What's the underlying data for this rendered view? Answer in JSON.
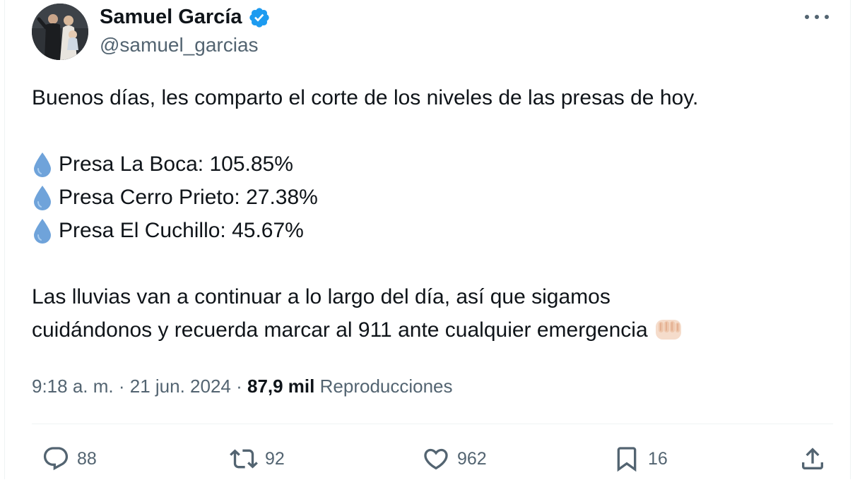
{
  "author": {
    "name": "Samuel García",
    "handle": "@samuel_garcias",
    "verified": true
  },
  "tweet": {
    "intro": "Buenos días, les comparto el corte de los niveles de las presas de hoy.",
    "dams": [
      {
        "icon": "droplet-icon",
        "text": "Presa La Boca: 105.85%"
      },
      {
        "icon": "droplet-icon",
        "text": "Presa Cerro Prieto: 27.38%"
      },
      {
        "icon": "droplet-icon",
        "text": "Presa El Cuchillo: 45.67%"
      }
    ],
    "closing_line1": "Las lluvias van a continuar a lo largo del día, así que sigamos",
    "closing_line2": "cuidándonos y recuerda marcar al 911 ante cualquier emergencia",
    "closing_emoji": "oncoming-fist-icon"
  },
  "meta": {
    "time": "9:18 a. m.",
    "separator": " · ",
    "date": "21 jun. 2024",
    "views_count": "87,9 mil",
    "views_label": "Reproducciones"
  },
  "actions": {
    "replies": "88",
    "retweets": "92",
    "likes": "962",
    "bookmarks": "16"
  },
  "colors": {
    "text": "#0f1419",
    "secondary": "#536471",
    "verified": "#1d9bf0",
    "droplet": "#6fa3da",
    "divider": "#eff3f4"
  }
}
